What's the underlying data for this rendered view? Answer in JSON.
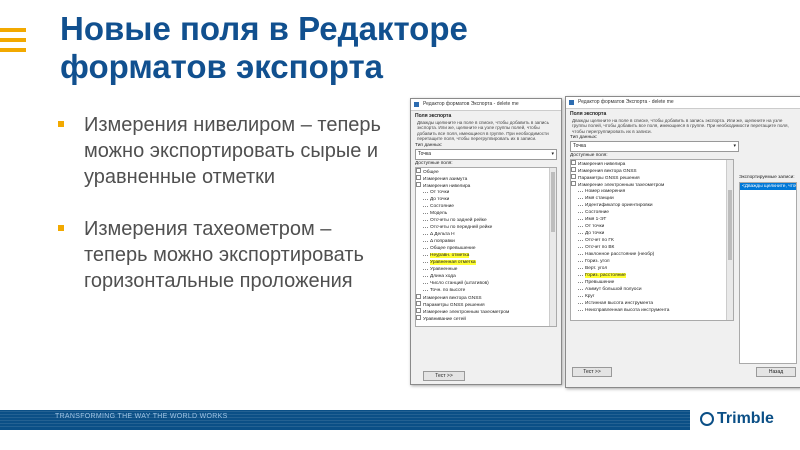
{
  "slide": {
    "title_line1": "Новые поля в Редакторе",
    "title_line2": "форматов экспорта",
    "bullets": [
      "Измерения нивелиром – теперь можно экспортировать сырые и уравненные отметки",
      "Измерения тахеометром – теперь можно экспортировать горизонтальные проложения"
    ],
    "footer_text": "TRANSFORMING THE WAY THE WORLD WORKS",
    "logo": "Trimble",
    "colors": {
      "title": "#11508f",
      "accent": "#f2a900",
      "footer": "#0b4f86"
    }
  },
  "dialog1": {
    "title": "Редактор форматов Экспорта - delete me",
    "section": "Поля экспорта",
    "description": "Дважды щелкните на поле в списке, чтобы добавить в запись экспорта. Или же, щелкните на узле группы полей, чтобы добавить все поля, имеющиеся в группе. При необходимости перетащите поля, чтобы перегруппировать их в записи.",
    "data_type_label": "Тип данных:",
    "data_type_value": "Точка",
    "available_label": "Доступные поля:",
    "tree": [
      {
        "text": "Общее",
        "level": 0,
        "hl": false
      },
      {
        "text": "Измерения азимута",
        "level": 0,
        "hl": false
      },
      {
        "text": "Измерения нивелира",
        "level": 0,
        "hl": false
      },
      {
        "text": "От точки",
        "level": 1,
        "hl": false
      },
      {
        "text": "До точки",
        "level": 1,
        "hl": false
      },
      {
        "text": "Состояние",
        "level": 1,
        "hl": false
      },
      {
        "text": "Модель",
        "level": 1,
        "hl": false
      },
      {
        "text": "Отсчеты по задней рейке",
        "level": 1,
        "hl": false
      },
      {
        "text": "Отсчеты по передней рейке",
        "level": 1,
        "hl": false
      },
      {
        "text": "Δ Дельта H",
        "level": 1,
        "hl": false
      },
      {
        "text": "Δ поправки",
        "level": 1,
        "hl": false
      },
      {
        "text": "Общее превышение",
        "level": 1,
        "hl": false
      },
      {
        "text": "Неуравн. отметка",
        "level": 1,
        "hl": true
      },
      {
        "text": "Уравненная отметка",
        "level": 1,
        "hl": true
      },
      {
        "text": "Уравненные",
        "level": 1,
        "hl": false
      },
      {
        "text": "Длина хода",
        "level": 1,
        "hl": false
      },
      {
        "text": "Число станций (штативов)",
        "level": 1,
        "hl": false
      },
      {
        "text": "Точн. по высоте",
        "level": 1,
        "hl": false
      },
      {
        "text": "Измерения вектора GNSS",
        "level": 0,
        "hl": false
      },
      {
        "text": "Параметры GNSS решения",
        "level": 0,
        "hl": false
      },
      {
        "text": "Измерение электронным тахеометром",
        "level": 0,
        "hl": false
      },
      {
        "text": "Уравнивание сетей",
        "level": 0,
        "hl": false
      }
    ],
    "test_button": "Тест >>"
  },
  "dialog2": {
    "title": "Редактор форматов Экспорта - delete me",
    "section": "Поля экспорта",
    "description": "Дважды щелкните на поле в списке, чтобы добавить в запись экспорта. Или же, щелкните на узле группы полей, чтобы добавить все поля, имеющиеся в группе. При необходимости перетащите поля, чтобы перегруппировать их в записи.",
    "data_type_label": "Тип данных:",
    "data_type_value": "Точка",
    "available_label": "Доступные поля:",
    "export_label": "Экспортируемые записи:",
    "export_item": "<Дважды щелкните, чтобы добавить>",
    "tree": [
      {
        "text": "Измерения нивелира",
        "level": 0,
        "hl": false
      },
      {
        "text": "Измерения вектора GNSS",
        "level": 0,
        "hl": false
      },
      {
        "text": "Параметры GNSS решения",
        "level": 0,
        "hl": false
      },
      {
        "text": "Измерение электронным тахеометром",
        "level": 0,
        "hl": false
      },
      {
        "text": "Номер измерения",
        "level": 1,
        "hl": false
      },
      {
        "text": "Имя станции",
        "level": 1,
        "hl": false
      },
      {
        "text": "Идентификатор ориентировки",
        "level": 1,
        "hl": false
      },
      {
        "text": "Состояние",
        "level": 1,
        "hl": false
      },
      {
        "text": "Имя 1-ЭТ",
        "level": 1,
        "hl": false
      },
      {
        "text": "От точки",
        "level": 1,
        "hl": false
      },
      {
        "text": "До точки",
        "level": 1,
        "hl": false
      },
      {
        "text": "Отсчет по ГК",
        "level": 1,
        "hl": false
      },
      {
        "text": "Отсчет по ВК",
        "level": 1,
        "hl": false
      },
      {
        "text": "Наклонное расстояние (необр)",
        "level": 1,
        "hl": false
      },
      {
        "text": "Гориз. угол",
        "level": 1,
        "hl": false
      },
      {
        "text": "Верт. угол",
        "level": 1,
        "hl": false
      },
      {
        "text": "Гориз. расстояние",
        "level": 1,
        "hl": true
      },
      {
        "text": "Превышение",
        "level": 1,
        "hl": false
      },
      {
        "text": "Азимут большой полуоси",
        "level": 1,
        "hl": false
      },
      {
        "text": "Круг",
        "level": 1,
        "hl": false
      },
      {
        "text": "Истинная высота инструмента",
        "level": 1,
        "hl": false
      },
      {
        "text": "Неисправленная высота инструмента",
        "level": 1,
        "hl": false
      }
    ],
    "test_button": "Тест >>",
    "next_button": "Назад"
  }
}
